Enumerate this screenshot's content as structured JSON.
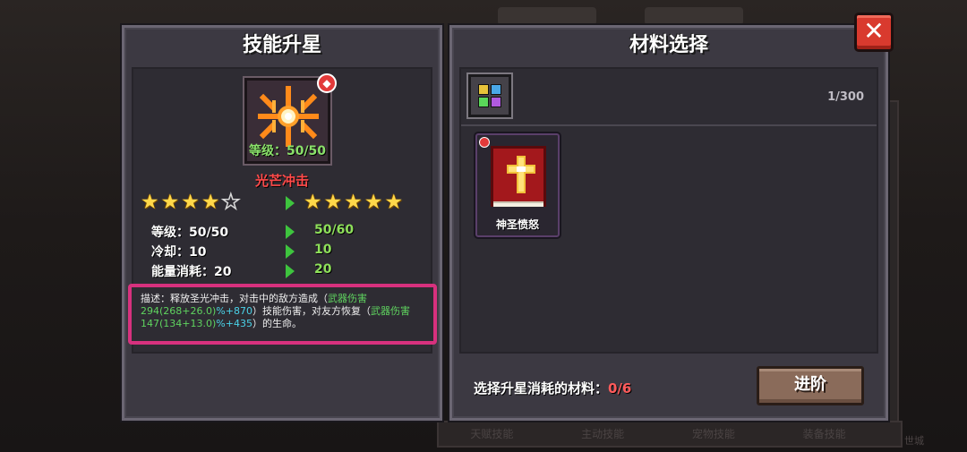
{
  "left_panel": {
    "title": "技能升星",
    "skill": {
      "level_label": "等级：50/50",
      "name": "光芒冲击",
      "current_stars": 4,
      "max_stars": 5,
      "next_stars": 5
    },
    "stats": [
      {
        "label": "等级：50/50",
        "next": "50/60"
      },
      {
        "label": "冷却：10",
        "next": "10"
      },
      {
        "label": "能量消耗：20",
        "next": "20"
      }
    ],
    "description": {
      "part1": "描述：释放圣光冲击，对击中的敌方造成（",
      "dmg_a": "武器伤害294(268+26.0)",
      "dmg_b": "%+870",
      "part2": "）技能伤害，对友方恢复（",
      "heal_a": "武器伤害147(134+13.0)",
      "heal_b": "%+435",
      "part3": "）的生命。"
    }
  },
  "right_panel": {
    "title": "材料选择",
    "counter": "1/300",
    "materials": [
      {
        "name": "神圣愤怒"
      }
    ],
    "select_label": "选择升星消耗的材料：",
    "select_count": "0/6",
    "advance_label": "进阶"
  },
  "close_label": "✕",
  "background": {
    "tabs": [
      "天赋技能",
      "主动技能",
      "宠物技能",
      "装备技能"
    ],
    "side_label": "世城"
  },
  "colors": {
    "panel_bg": "#3c3942",
    "highlight_border": "#d7317e",
    "skill_name": "#ff4a4a",
    "upgrade_value": "#8ee05a",
    "close_button": "#d93a2e",
    "advance_button": "#8a6b5a"
  }
}
